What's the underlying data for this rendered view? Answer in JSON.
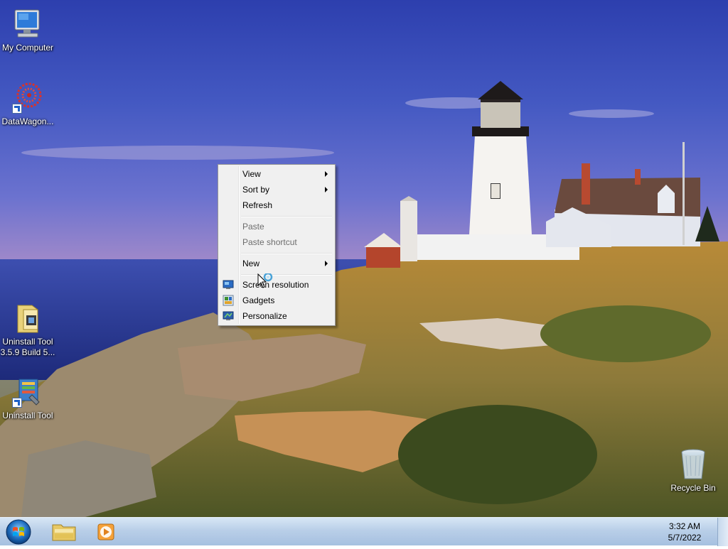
{
  "desktop": {
    "icons": [
      {
        "label": "My Computer",
        "icon": "computer-icon"
      },
      {
        "label": "DataWagon...",
        "icon": "datawagon-icon"
      },
      {
        "label": "Uninstall Tool 3.5.9 Build 5...",
        "icon": "folder-icon"
      },
      {
        "label": "Uninstall Tool",
        "icon": "uninstall-tool-icon"
      },
      {
        "label": "Recycle Bin",
        "icon": "recycle-bin-icon"
      }
    ]
  },
  "context_menu": {
    "items": [
      {
        "label": "View",
        "submenu": true,
        "enabled": true
      },
      {
        "label": "Sort by",
        "submenu": true,
        "enabled": true
      },
      {
        "label": "Refresh",
        "submenu": false,
        "enabled": true
      },
      {
        "label": "Paste",
        "submenu": false,
        "enabled": false
      },
      {
        "label": "Paste shortcut",
        "submenu": false,
        "enabled": false
      },
      {
        "label": "New",
        "submenu": true,
        "enabled": true
      },
      {
        "label": "Screen resolution",
        "submenu": false,
        "enabled": true,
        "icon": "screen-resolution-icon"
      },
      {
        "label": "Gadgets",
        "submenu": false,
        "enabled": true,
        "icon": "gadgets-icon"
      },
      {
        "label": "Personalize",
        "submenu": false,
        "enabled": true,
        "icon": "personalize-icon"
      }
    ]
  },
  "taskbar": {
    "start_icon": "windows-start-icon",
    "pinned": [
      {
        "icon": "file-explorer-icon"
      },
      {
        "icon": "media-player-icon"
      }
    ],
    "clock": {
      "time": "3:32 AM",
      "date": "5/7/2022"
    }
  },
  "colors": {
    "taskbar": "#b9cfe8",
    "menu_bg": "#f0f0f0",
    "disabled_text": "#6d6d6d"
  }
}
